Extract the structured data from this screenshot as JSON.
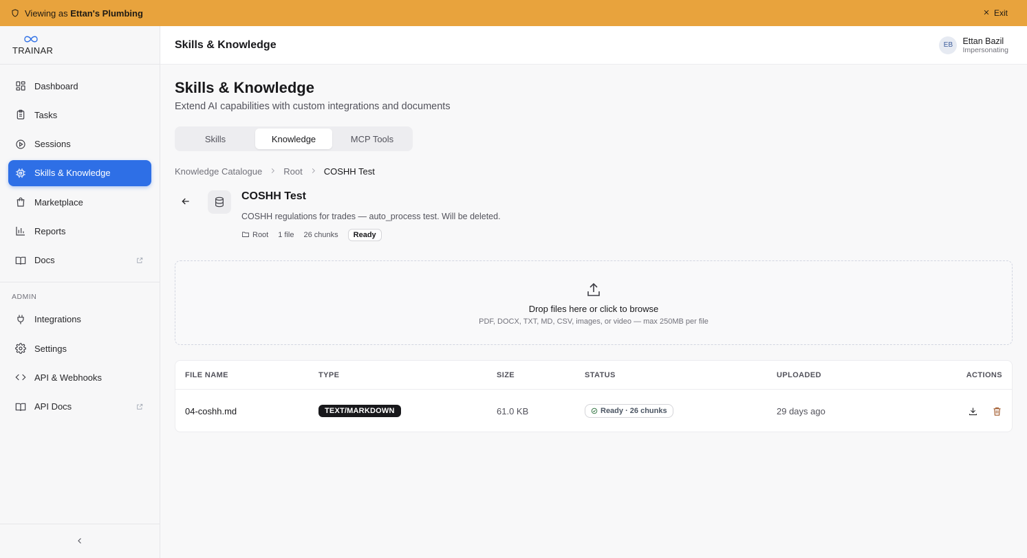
{
  "banner": {
    "viewing_prefix": "Viewing as ",
    "viewing_org": "Ettan's Plumbing",
    "exit_label": "Exit",
    "color": "#e8a33d"
  },
  "brand": {
    "name": "TRAINAR"
  },
  "sidebar": {
    "items": [
      {
        "label": "Dashboard",
        "icon": "dashboard-icon"
      },
      {
        "label": "Tasks",
        "icon": "clipboard-icon"
      },
      {
        "label": "Sessions",
        "icon": "play-circle-icon"
      },
      {
        "label": "Skills & Knowledge",
        "icon": "chip-icon",
        "active": true
      },
      {
        "label": "Marketplace",
        "icon": "shopping-bag-icon"
      },
      {
        "label": "Reports",
        "icon": "bar-chart-icon"
      },
      {
        "label": "Docs",
        "icon": "book-icon",
        "external": true
      }
    ],
    "admin_label": "ADMIN",
    "admin_items": [
      {
        "label": "Integrations",
        "icon": "plug-icon"
      },
      {
        "label": "Settings",
        "icon": "gear-icon"
      },
      {
        "label": "API & Webhooks",
        "icon": "code-icon"
      },
      {
        "label": "API Docs",
        "icon": "book-icon",
        "external": true
      }
    ],
    "accent": "#2e6fe6"
  },
  "topbar": {
    "title": "Skills & Knowledge",
    "user_initials": "EB",
    "user_name": "Ettan Bazil",
    "user_status": "Impersonating"
  },
  "page": {
    "title": "Skills & Knowledge",
    "subtitle": "Extend AI capabilities with custom integrations and documents",
    "tabs": [
      {
        "label": "Skills"
      },
      {
        "label": "Knowledge",
        "active": true
      },
      {
        "label": "MCP Tools"
      }
    ],
    "breadcrumbs": [
      "Knowledge Catalogue",
      "Root",
      "COSHH Test"
    ]
  },
  "kb": {
    "title": "COSHH Test",
    "description": "COSHH regulations for trades — auto_process test. Will be deleted.",
    "folder": "Root",
    "files": "1 file",
    "chunks": "26 chunks",
    "status": "Ready"
  },
  "dropzone": {
    "title": "Drop files here or click to browse",
    "subtitle": "PDF, DOCX, TXT, MD, CSV, images, or video — max 250MB per file"
  },
  "table": {
    "headers": [
      "FILE NAME",
      "TYPE",
      "SIZE",
      "STATUS",
      "UPLOADED",
      "ACTIONS"
    ],
    "rows": [
      {
        "name": "04-coshh.md",
        "type": "TEXT/MARKDOWN",
        "size": "61.0 KB",
        "status": "Ready · 26 chunks",
        "uploaded": "29 days ago"
      }
    ]
  }
}
